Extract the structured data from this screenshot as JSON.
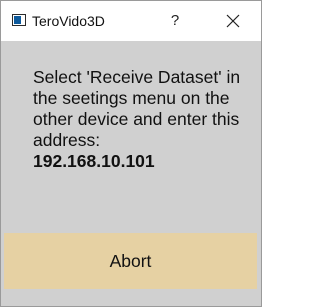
{
  "window": {
    "title": "TeroVido3D",
    "help_label": "?",
    "app_icon": "app-window-icon",
    "close_icon": "close-icon"
  },
  "dialog": {
    "message": "Select 'Receive Dataset' in the seetings menu on the other device and enter this address:",
    "address": "192.168.10.101",
    "abort_label": "Abort"
  },
  "colors": {
    "dialog_background": "#d0d0d0",
    "titlebar_background": "#ffffff",
    "abort_button": "#e6d1a3",
    "app_icon_fill": "#0d5a9c"
  }
}
